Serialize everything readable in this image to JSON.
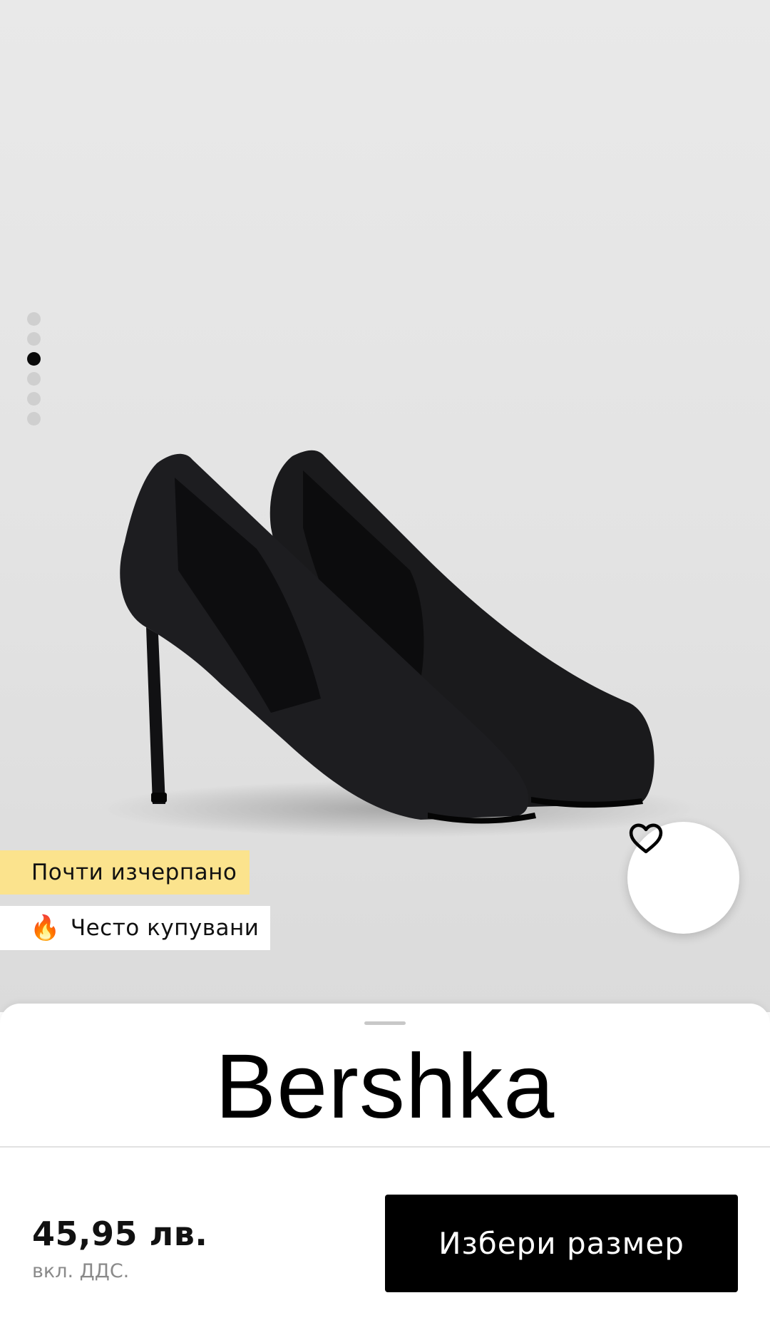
{
  "product": {
    "image_alt": "black pointed-toe stiletto pumps",
    "gallery": {
      "total": 6,
      "active_index": 2
    },
    "badges": {
      "low_stock": "Почти изчерпано",
      "popular": "Често купувани",
      "popular_icon": "fire-icon"
    },
    "favorite_icon": "heart-outline-icon"
  },
  "sheet": {
    "brand": "Bershka",
    "price": "45,95 лв.",
    "vat_note": "вкл. ДДС.",
    "cta_label": "Избери размер"
  },
  "colors": {
    "badge_low_stock_bg": "#fbe38d",
    "cta_bg": "#000000",
    "cta_text": "#ffffff"
  }
}
